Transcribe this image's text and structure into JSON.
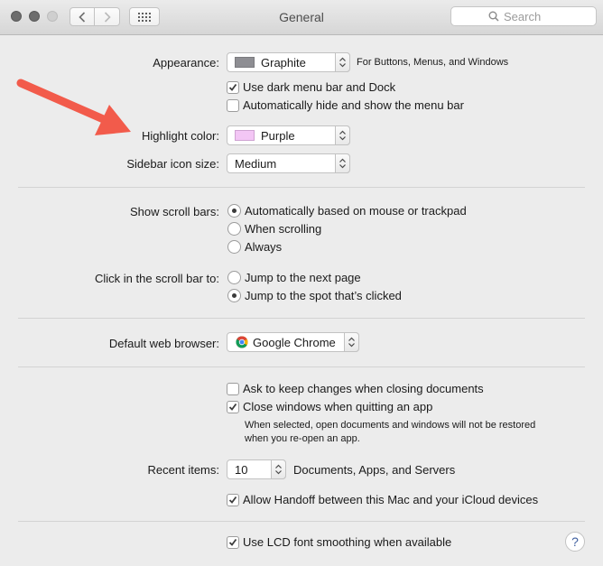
{
  "window": {
    "title": "General"
  },
  "search": {
    "placeholder": "Search"
  },
  "appearance": {
    "label": "Appearance:",
    "value": "Graphite",
    "swatch_color": "#8e8e93",
    "note": "For Buttons, Menus, and Windows"
  },
  "dark_menu": {
    "label": "Use dark menu bar and Dock",
    "checked": true
  },
  "auto_hide": {
    "label": "Automatically hide and show the menu bar",
    "checked": false
  },
  "highlight": {
    "label": "Highlight color:",
    "value": "Purple",
    "swatch_color": "#f3c6f5"
  },
  "sidebar_icon": {
    "label": "Sidebar icon size:",
    "value": "Medium"
  },
  "scroll_bars": {
    "label": "Show scroll bars:",
    "options": [
      "Automatically based on mouse or trackpad",
      "When scrolling",
      "Always"
    ],
    "selected": 0
  },
  "click_scroll": {
    "label": "Click in the scroll bar to:",
    "options": [
      "Jump to the next page",
      "Jump to the spot that’s clicked"
    ],
    "selected": 1
  },
  "browser": {
    "label": "Default web browser:",
    "value": "Google Chrome"
  },
  "ask_keep": {
    "label": "Ask to keep changes when closing documents",
    "checked": false
  },
  "close_windows": {
    "label": "Close windows when quitting an app",
    "checked": true,
    "note_line1": "When selected, open documents and windows will not be restored",
    "note_line2": "when you re-open an app."
  },
  "recent": {
    "label": "Recent items:",
    "value": "10",
    "suffix": "Documents, Apps, and Servers"
  },
  "handoff": {
    "label": "Allow Handoff between this Mac and your iCloud devices",
    "checked": true
  },
  "lcd": {
    "label": "Use LCD font smoothing when available",
    "checked": true
  },
  "help": {
    "label": "?"
  },
  "colors": {
    "annotation_arrow": "#f25b4b",
    "checkmark": "#3d3d3d"
  }
}
